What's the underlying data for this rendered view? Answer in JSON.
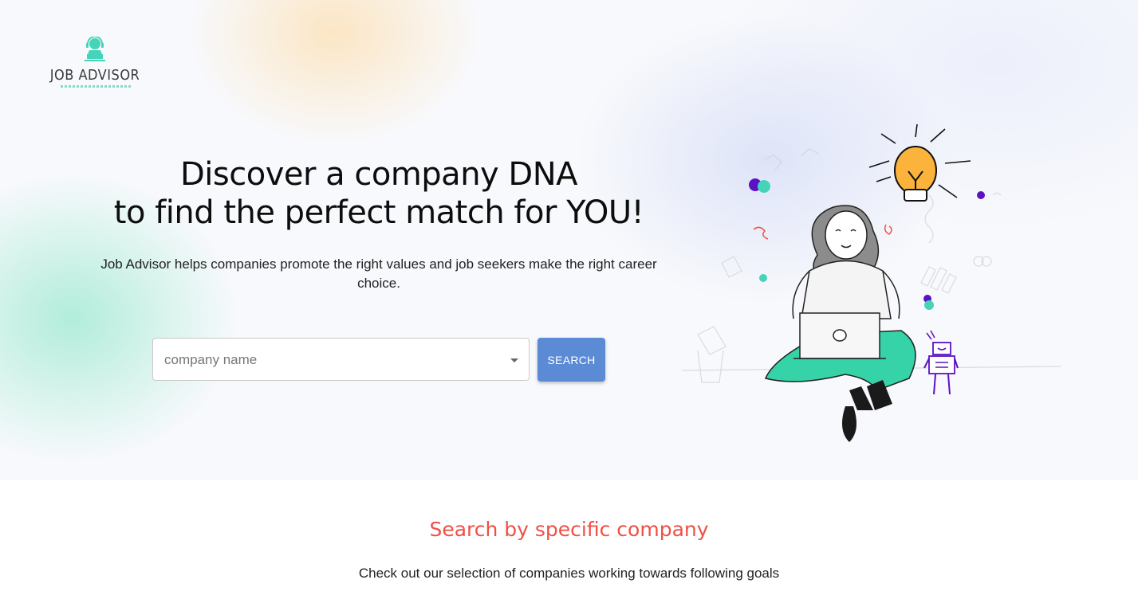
{
  "brand": {
    "name": "JOB ADVISOR",
    "logo_icon": "headset-person-icon",
    "accent_color": "#45d4b8"
  },
  "hero": {
    "headline_line1": "Discover a company DNA",
    "headline_line2": "to find the perfect match for YOU!",
    "subtitle": "Job Advisor helps companies promote the right values and job seekers make the right career choice.",
    "search": {
      "placeholder": "company name",
      "value": "",
      "button_label": "SEARCH",
      "button_color": "#5b8bd4"
    },
    "illustration_icon": "woman-laptop-lightbulb-illustration"
  },
  "section": {
    "title": "Search by specific company",
    "title_color": "#ef5046",
    "subtitle": "Check out our selection of companies working towards following goals"
  }
}
